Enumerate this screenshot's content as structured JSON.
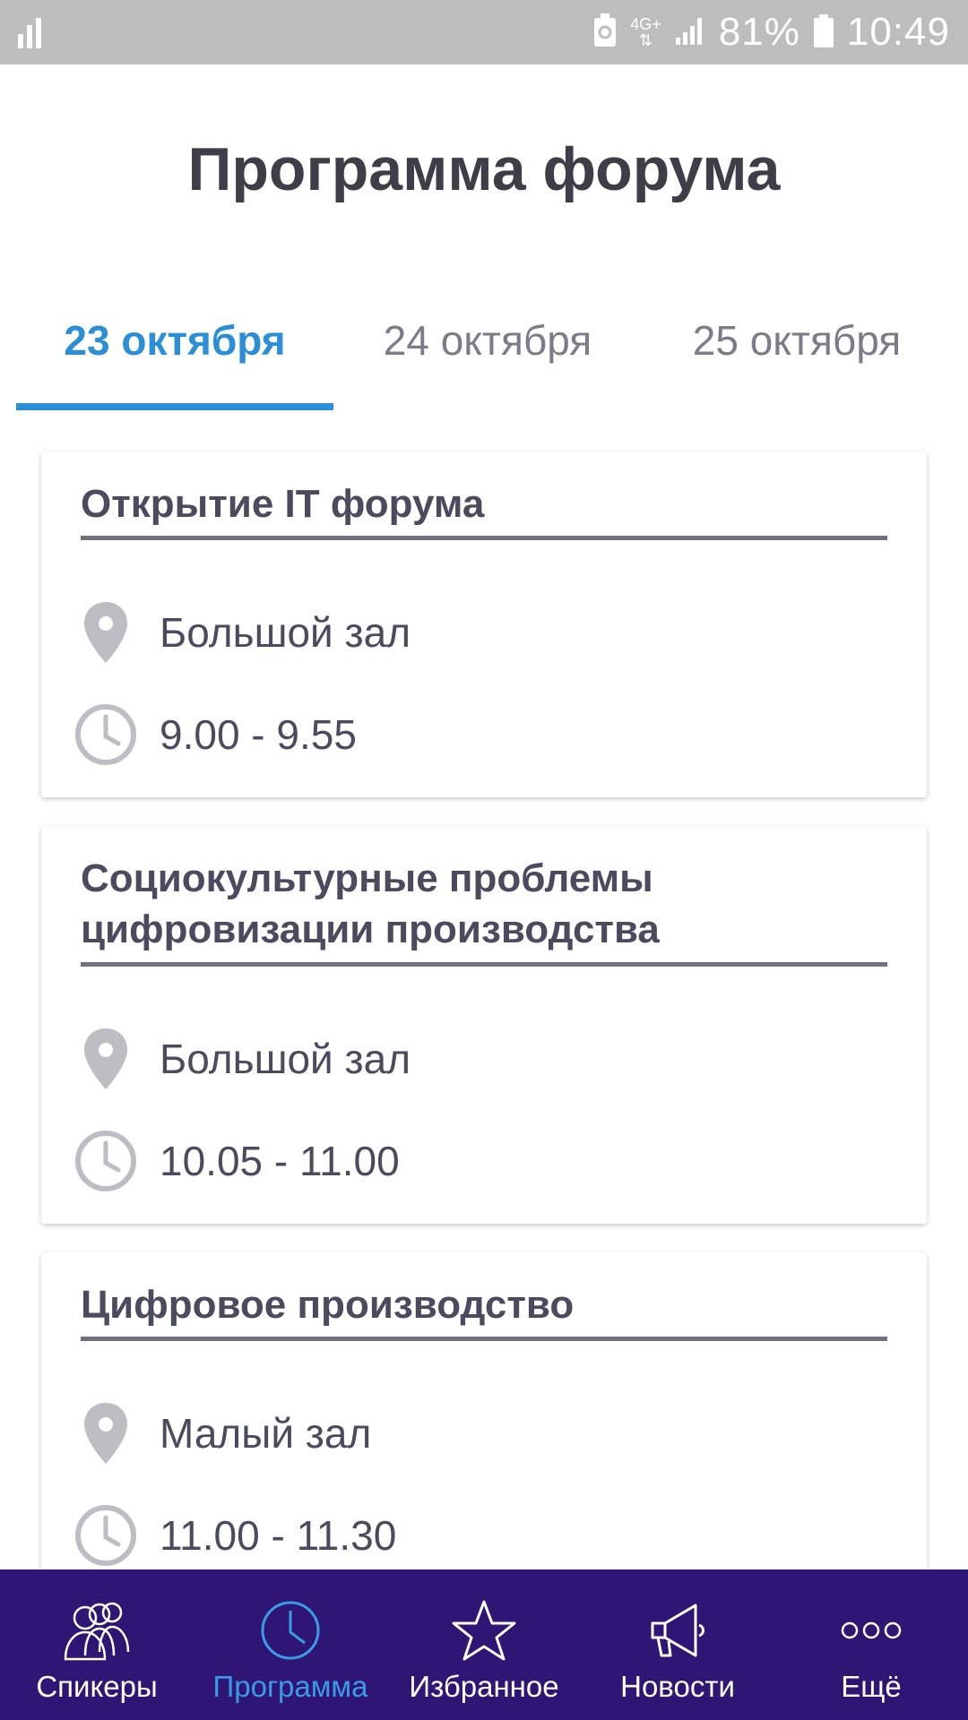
{
  "status_bar": {
    "network": "4G+",
    "battery": "81%",
    "time": "10:49"
  },
  "page": {
    "title": "Программа форума"
  },
  "tabs": [
    {
      "label": "23 октября",
      "active": true
    },
    {
      "label": "24 октября",
      "active": false
    },
    {
      "label": "25 октября",
      "active": false
    }
  ],
  "sessions": [
    {
      "title": "Открытие IT форума",
      "location": "Большой зал",
      "time": "9.00 - 9.55"
    },
    {
      "title_line1": "Социокультурные проблемы",
      "title_line2": "цифровизации производства",
      "location": "Большой зал",
      "time": "10.05 - 11.00"
    },
    {
      "title": "Цифровое производство",
      "location": "Малый зал",
      "time": "11.00 - 11.30"
    }
  ],
  "bottom_nav": [
    {
      "label": "Спикеры",
      "icon": "speakers-icon",
      "active": false
    },
    {
      "label": "Программа",
      "icon": "clock-icon",
      "active": true
    },
    {
      "label": "Избранное",
      "icon": "star-icon",
      "active": false
    },
    {
      "label": "Новости",
      "icon": "megaphone-icon",
      "active": false
    },
    {
      "label": "Ещё",
      "icon": "more-dots-icon",
      "active": false
    }
  ],
  "colors": {
    "accent": "#2b8fd8",
    "nav_background": "#2f1674",
    "status_bar": "#bdbdbd",
    "title_text": "#3e3e48",
    "icon_grey": "#bdbdc3"
  }
}
